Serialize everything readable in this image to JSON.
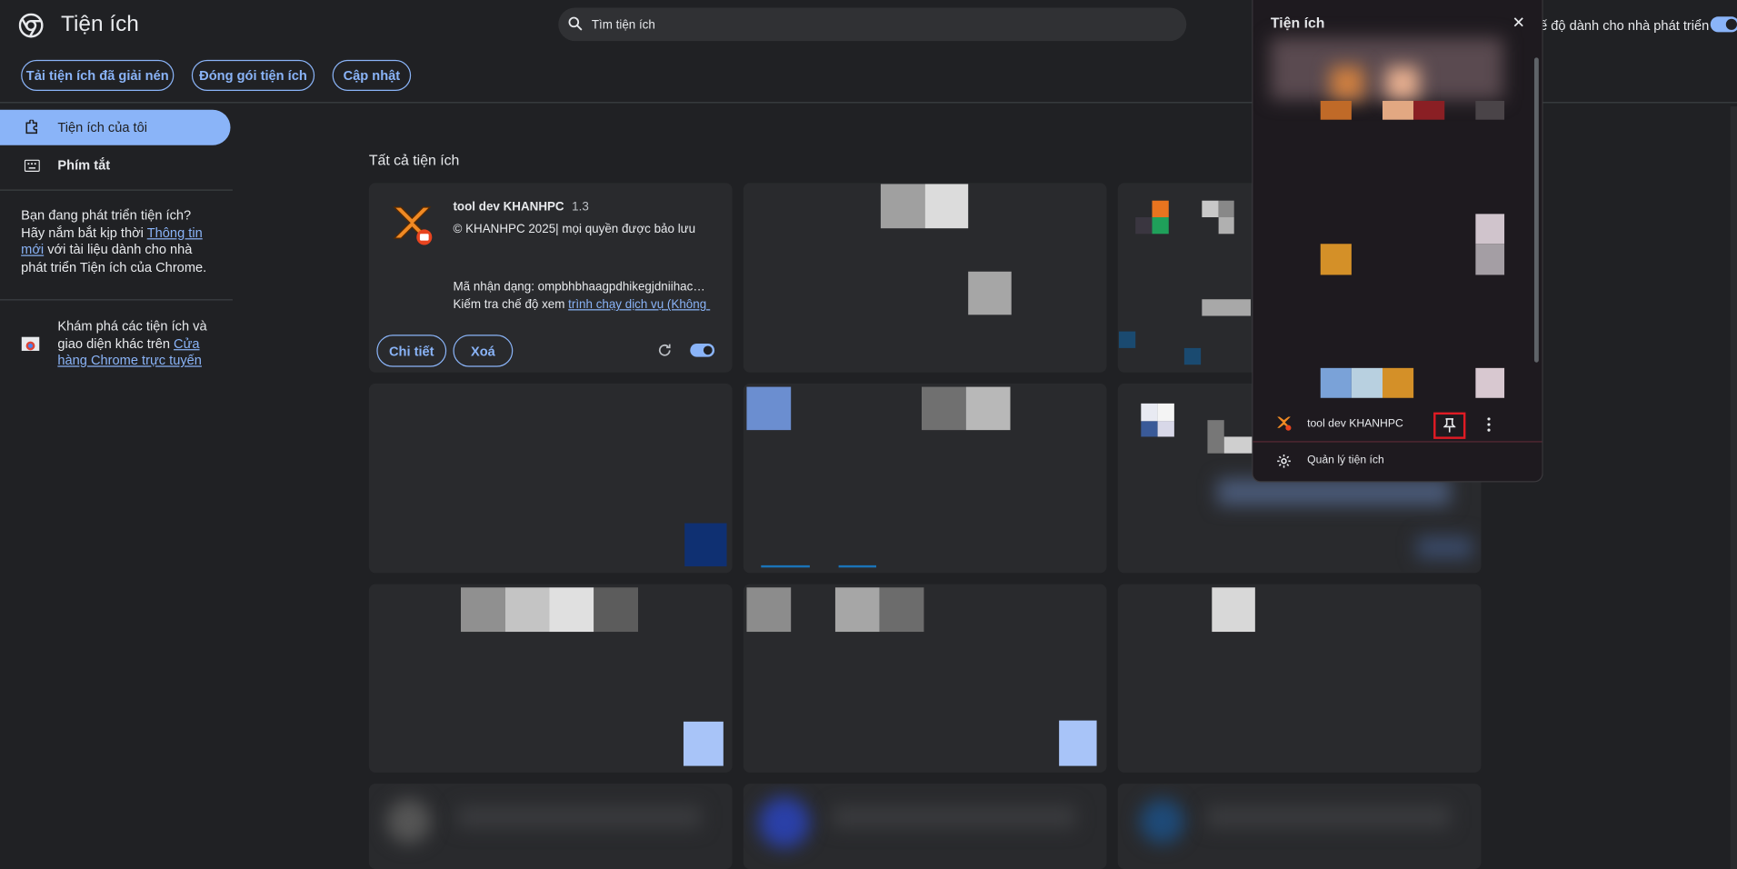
{
  "header": {
    "title": "Tiện ích",
    "search_placeholder": "Tìm tiện ích",
    "dev_mode_label": "ế độ dành cho nhà phát triển"
  },
  "toolbar": {
    "load_unpacked": "Tải tiện ích đã giải nén",
    "pack": "Đóng gói tiện ích",
    "update": "Cập nhật"
  },
  "sidebar": {
    "my_extensions": "Tiện ích của tôi",
    "shortcuts": "Phím tắt",
    "dev_text_1": "Bạn đang phát triển tiện ích?",
    "dev_text_2": "Hãy nắm bắt kịp thời ",
    "dev_link_1": "Thông tin",
    "dev_link_2": "mới",
    "dev_text_3": " với tài liệu dành cho nhà",
    "dev_text_4": "phát triển Tiện ích của Chrome.",
    "store_text_1": "Khám phá các tiện ích và",
    "store_text_2": "giao diện khác trên ",
    "store_link_1": "Cửa",
    "store_link_2": "hàng Chrome trực tuyến"
  },
  "main": {
    "section_title": "Tất cả tiện ích",
    "card": {
      "name": "tool dev KHANHPC",
      "version": "1.3",
      "description": "© KHANHPC 2025| mọi quyền được bảo lưu",
      "id_text": "Mã nhận dạng: ompbhbhaagpdhikegjdniihachn...",
      "inspect_text": "Kiểm tra chế độ xem ",
      "inspect_link": "trình chạy dịch vụ (Không ...",
      "details": "Chi tiết",
      "remove": "Xoá"
    }
  },
  "popup": {
    "title": "Tiện ích",
    "close": "✕",
    "item_name": "tool dev KHANHPC",
    "manage": "Quản lý tiện ích"
  },
  "colors": {
    "accent": "#8ab4f8",
    "background": "#202124",
    "card": "#292a2d",
    "highlight": "#e01b24"
  }
}
